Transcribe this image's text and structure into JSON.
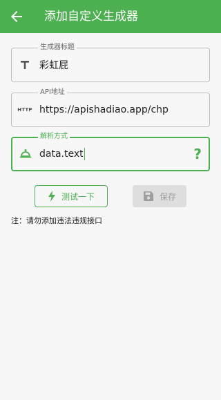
{
  "appbar": {
    "title": "添加自定义生成器",
    "back_icon": "arrow-back-icon"
  },
  "fields": {
    "name": {
      "label": "生成器标题",
      "value": "彩虹屁",
      "icon": "title-T-icon"
    },
    "api": {
      "label": "API地址",
      "value": "https://apishadiao.app/chp",
      "icon_text": "HTTP"
    },
    "parse": {
      "label": "解析方式",
      "value": "data.text",
      "icon": "bell-icon",
      "help": "?"
    }
  },
  "buttons": {
    "test_label": "测试一下",
    "test_icon": "lightning-icon",
    "save_label": "保存",
    "save_icon": "save-icon"
  },
  "note": "注：请勿添加违法违规接口",
  "colors": {
    "primary": "#4caf50",
    "background": "#f7f7f7",
    "disabled_bg": "#dedede",
    "disabled_text": "#9e9e9e"
  }
}
